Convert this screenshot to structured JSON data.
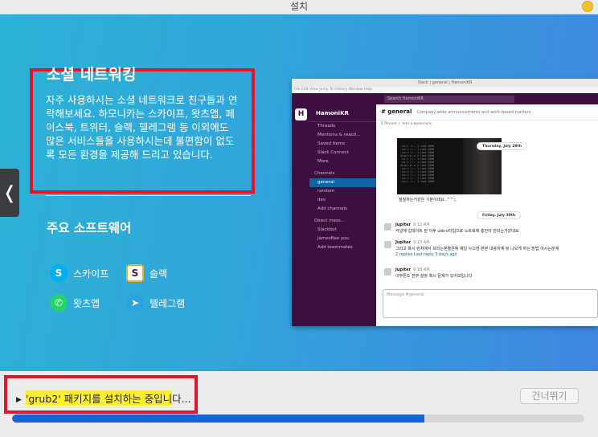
{
  "window": {
    "title": "설치"
  },
  "slide": {
    "title": "소셜 네트워킹",
    "body": "자주 사용하시는 소셜 네트워크로 친구들과 연락해보세요. 하모니카는 스카이프, 왓츠앱, 페이스북, 트위터, 슬랙, 텔레그램 등 이외에도 많은 서비스들을 사용하시는데 불편함이 없도록 모든 환경을 제공해 드리고 있습니다.",
    "software_title": "주요 소프트웨어",
    "software": [
      {
        "label": "스카이프",
        "icon": "skype-icon",
        "color": "#00aff0",
        "glyph": "S"
      },
      {
        "label": "슬랙",
        "icon": "slack-icon",
        "color": "#4a154b",
        "glyph": "S"
      },
      {
        "label": "왓츠앱",
        "icon": "whatsapp-icon",
        "color": "#25d366",
        "glyph": "✆"
      },
      {
        "label": "텔레그램",
        "icon": "telegram-icon",
        "color": "#2aa3df",
        "glyph": "➤"
      }
    ],
    "prev": "❬",
    "next": "❭"
  },
  "shot": {
    "title": "Slack | general | HamoniKR",
    "menu": "File  Edit  View  Jump To  History  Window  Help",
    "search": "Search HamoniKR",
    "workspace": "HamoniKR",
    "ws_letter": "H",
    "sidebar": [
      "Threads",
      "Mentions & reacti...",
      "Saved items",
      "Slack Connect",
      "More"
    ],
    "channels_header": "Channels",
    "channels": [
      "general",
      "random",
      "dev"
    ],
    "add_channels": "Add channels",
    "dm_header": "Direct mess...",
    "dms": [
      "Slackbot",
      "JamesBae  you"
    ],
    "add_teammates": "Add teammates",
    "channel_name": "# general",
    "channel_desc": "Company-wide announcements and work-based matters",
    "pinned": "1 Pinned   +  Add a bookmark",
    "date1": "Thursday, July 29th",
    "caption": "질질하는거같은 기분이네요..^^;;",
    "date2": "Friday, July 30th",
    "messages": [
      {
        "who": "Jupiter",
        "time": "9:12 AM",
        "text": "커널에 업데이트 된 이후 usb-c타입으로 노트북에 충전이 안되는거같네요"
      },
      {
        "who": "Jupiter",
        "time": "9:13 AM",
        "text": "그리고 혹시 런처에서 프리는분들은에 예일 누으면 본본 내용하계 뷰 나오게 하는 방법 아시는분계"
      },
      {
        "who": "",
        "time": "",
        "text": "2 replies  Last reply 3 days ago"
      },
      {
        "who": "Jupiter",
        "time": "9:18 AM",
        "text": "이무튼도 전부 설정 혹시 문제가 있어보입니다"
      }
    ],
    "composer": "Message #general"
  },
  "status": {
    "highlighted": "'grub2' 패키지를 설치하는 중입니",
    "rest": "다..."
  },
  "skip_label": "건너뛰기",
  "progress": 0.72
}
